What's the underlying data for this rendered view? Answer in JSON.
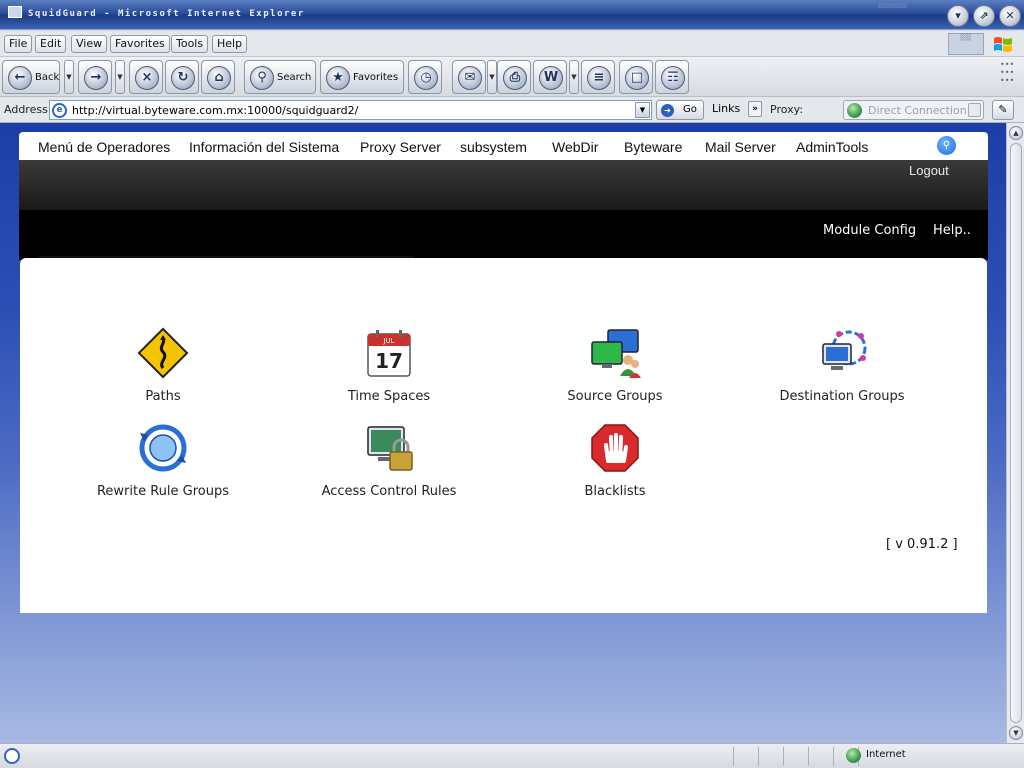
{
  "window": {
    "title": "SquidGuard - Microsoft Internet Explorer",
    "controls": [
      "minimize",
      "restore",
      "close"
    ]
  },
  "menu": [
    "File",
    "Edit",
    "View",
    "Favorites",
    "Tools",
    "Help"
  ],
  "toolbar": {
    "back_label": "Back",
    "search_label": "Search",
    "favorites_label": "Favorites"
  },
  "address": {
    "label": "Address",
    "url": "http://virtual.byteware.com.mx:10000/squidguard2/",
    "go_label": "Go",
    "links_label": "Links",
    "proxy_label": "Proxy:",
    "proxy_value": "Direct Connection"
  },
  "page": {
    "nav": [
      "Menú de Operadores",
      "Información del Sistema",
      "Proxy Server",
      "subsystem",
      "WebDir",
      "Byteware",
      "Mail Server",
      "AdminTools"
    ],
    "logout": "Logout",
    "module_config": "Module Config",
    "help": "Help..",
    "modules": [
      {
        "label": "Paths",
        "icon": "road-sign-icon"
      },
      {
        "label": "Time Spaces",
        "icon": "calendar-icon",
        "calendar_day": "17",
        "calendar_month": "JUL"
      },
      {
        "label": "Source Groups",
        "icon": "computers-users-icon"
      },
      {
        "label": "Destination Groups",
        "icon": "network-computer-icon"
      },
      {
        "label": "Rewrite Rule Groups",
        "icon": "rewrite-globe-icon"
      },
      {
        "label": "Access Control Rules",
        "icon": "computer-lock-icon"
      },
      {
        "label": "Blacklists",
        "icon": "stop-hand-icon"
      }
    ],
    "version": "[ v 0.91.2 ]"
  },
  "status": {
    "zone": "Internet"
  },
  "colors": {
    "title_bar": "#2b4d9a",
    "page_background": "#2c4fb5",
    "nav_dark": "#1a1a1a",
    "accent": "#1a6fe0"
  }
}
